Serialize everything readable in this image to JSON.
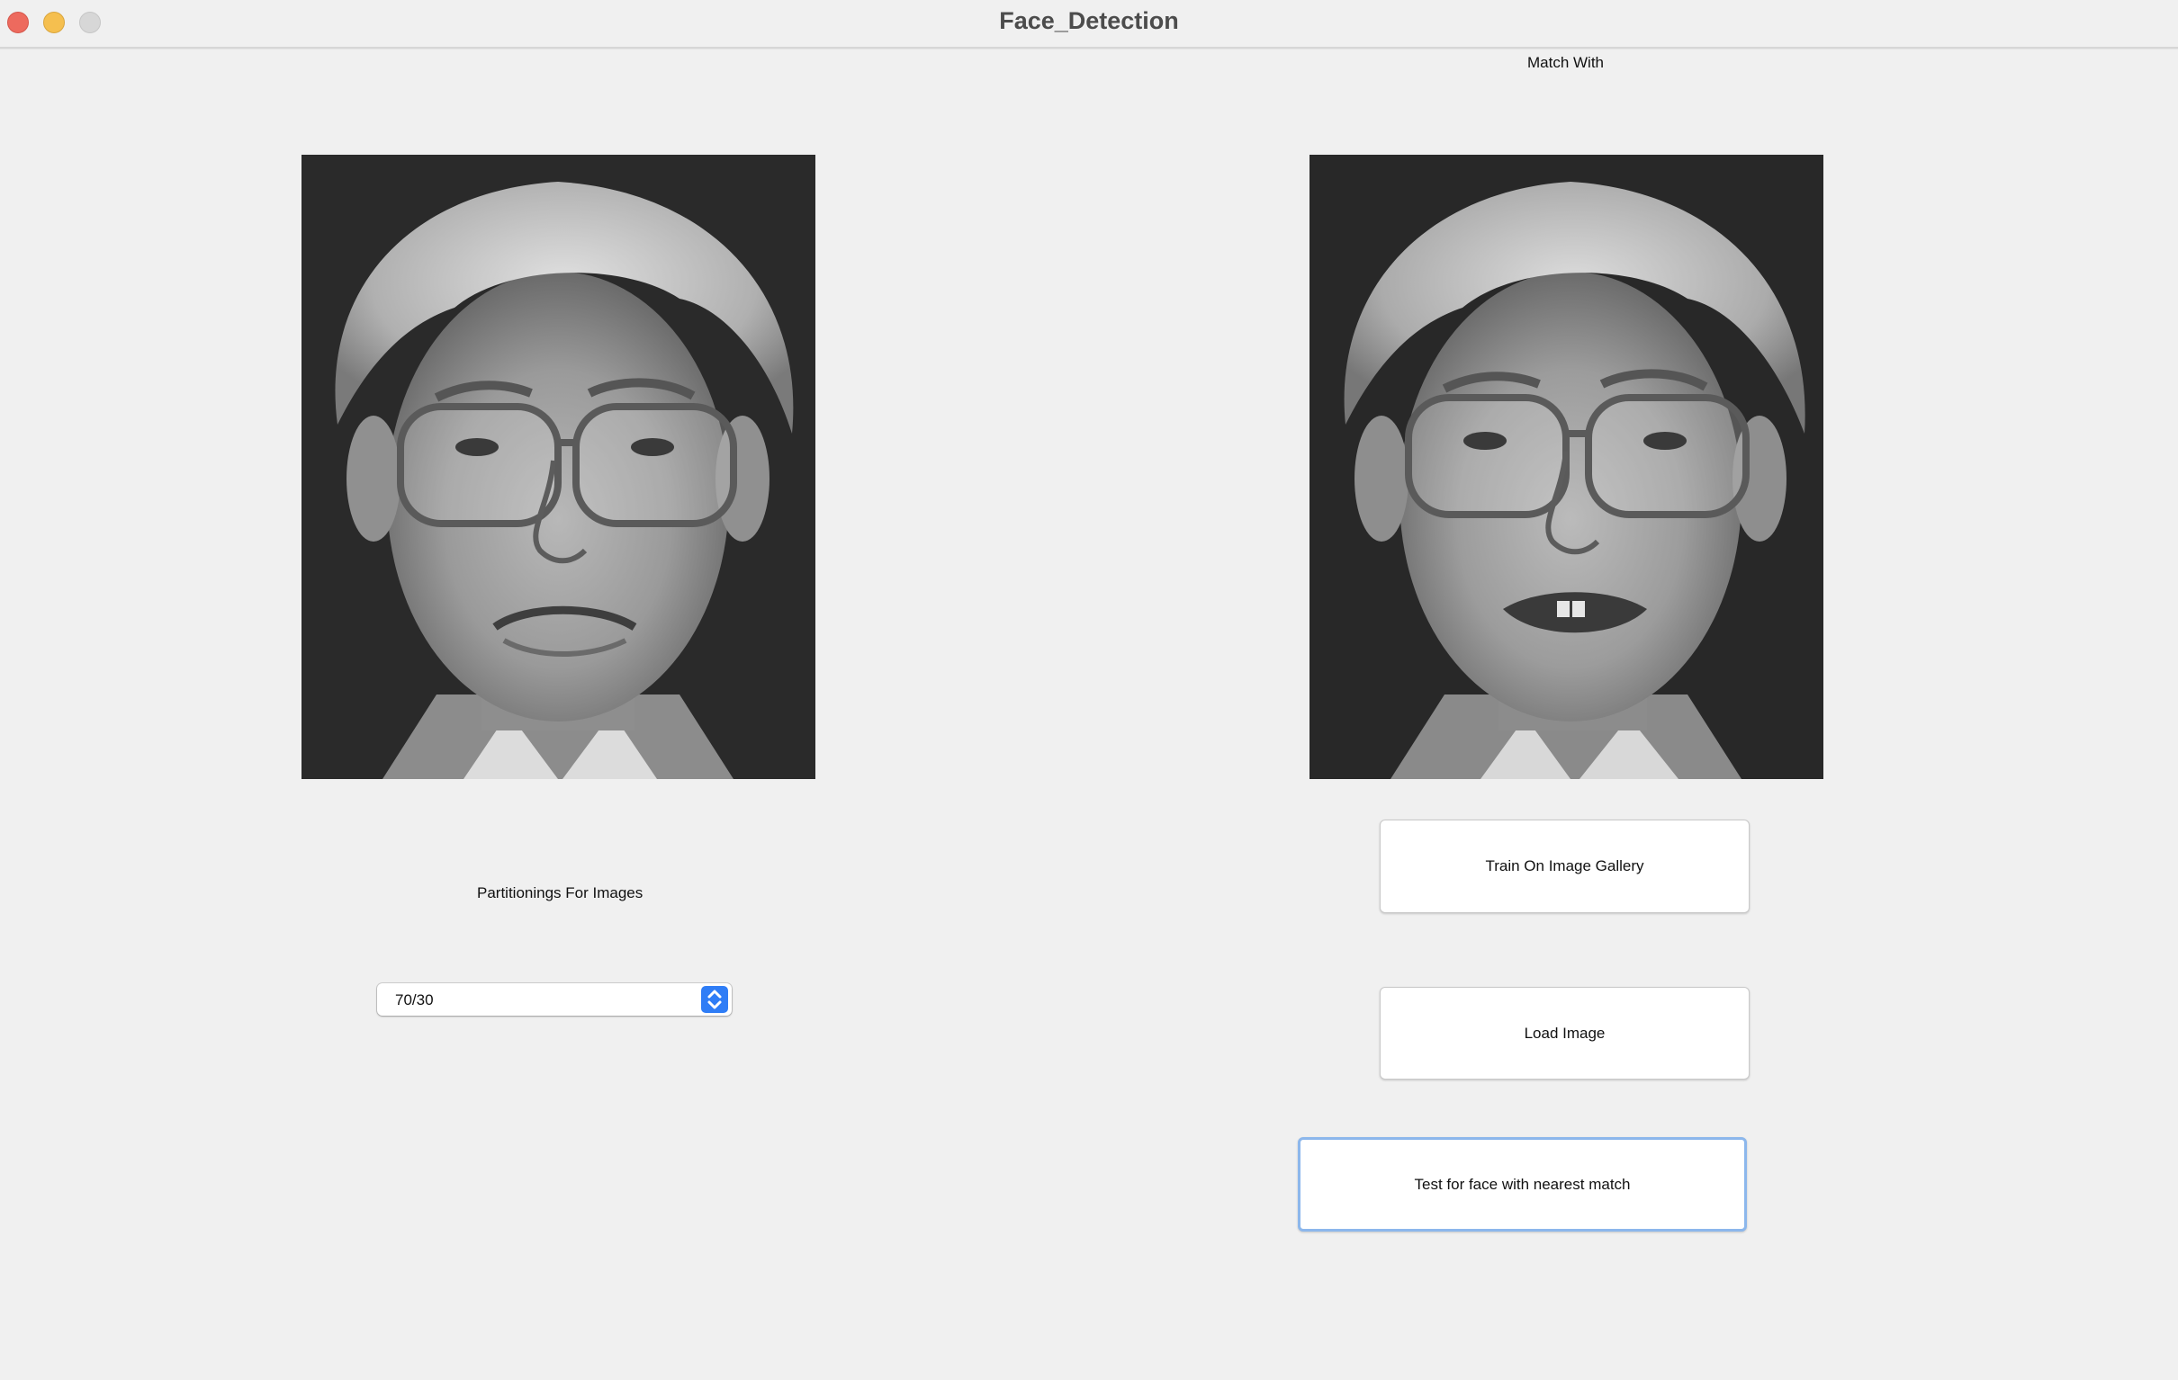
{
  "window": {
    "title": "Face_Detection",
    "controls": [
      "close",
      "minimize",
      "zoom"
    ]
  },
  "left_panel": {
    "image_description": "grayscale-face-photo",
    "partition_label": "Partitionings For Images",
    "partition_select": {
      "selected": "70/30"
    }
  },
  "right_panel": {
    "match_label": "Match With",
    "image_description": "grayscale-face-photo",
    "buttons": {
      "train": "Train On Image Gallery",
      "load": "Load Image",
      "test": "Test for face with nearest match"
    }
  },
  "colors": {
    "background": "#f0f0f0",
    "accent": "#2f7df6",
    "focus_ring": "#8cb7ec",
    "close": "#ed6a5e",
    "minimize": "#f5bf4f",
    "zoom_disabled": "#d7d7d7"
  }
}
